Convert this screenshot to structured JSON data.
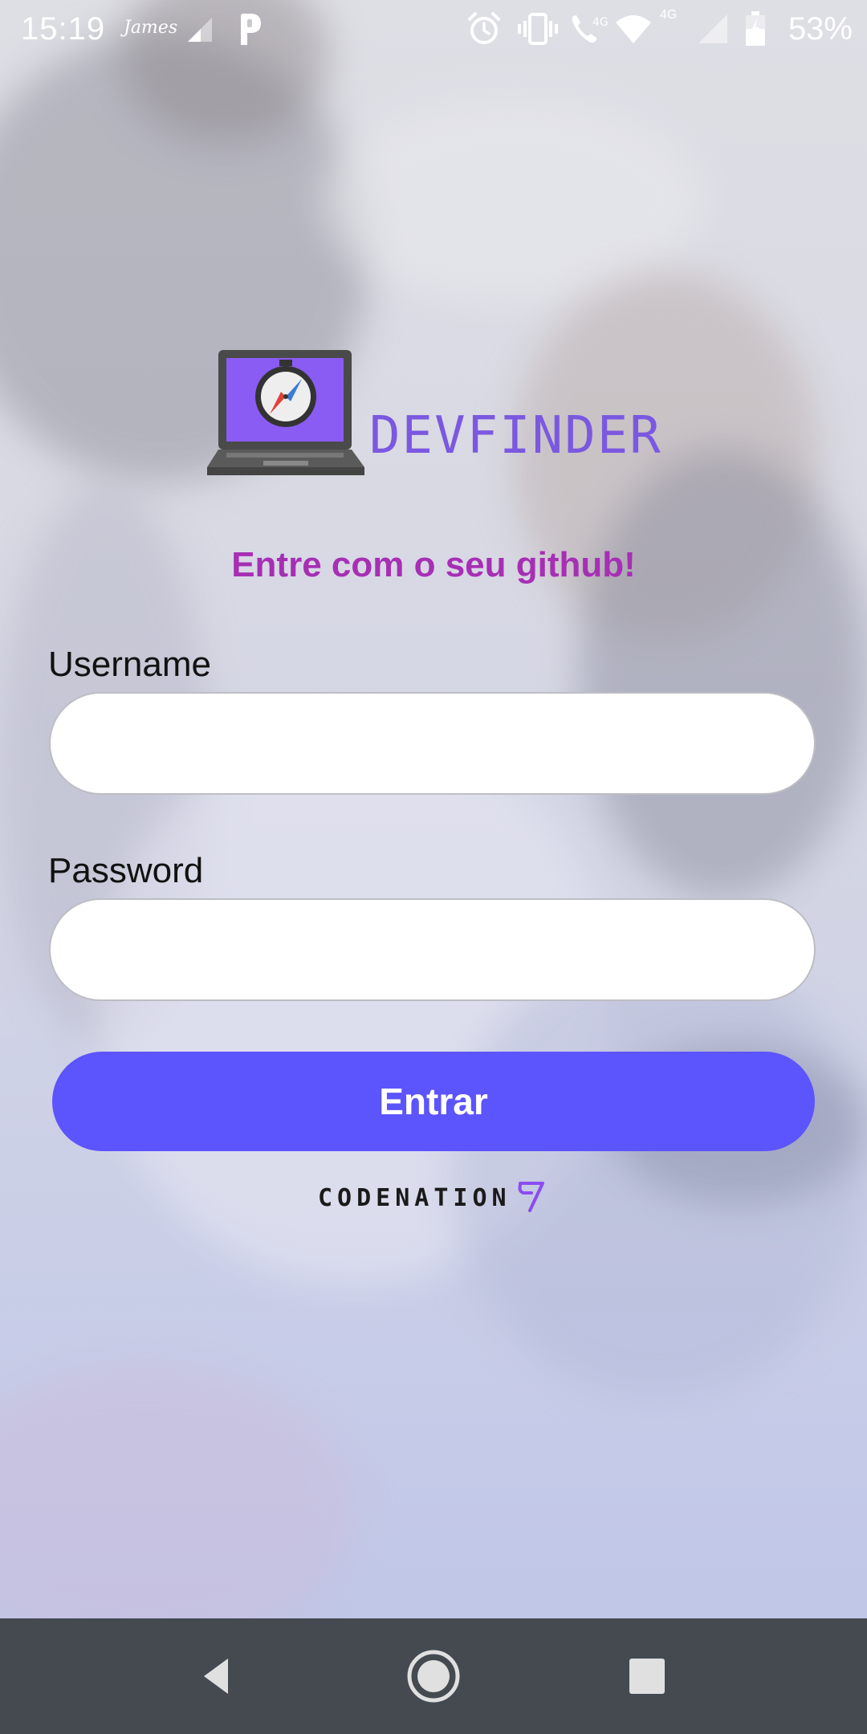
{
  "status_bar": {
    "time": "15:19",
    "carrier_brand": "James",
    "network_badge_1": "4G",
    "network_badge_2": "4G",
    "battery_percent": "53%",
    "icons": [
      "signal-weak-icon",
      "parking-app-icon",
      "alarm-icon",
      "vibrate-icon",
      "wifi-call-icon",
      "wifi-icon",
      "cell-signal-icon",
      "battery-icon"
    ]
  },
  "app": {
    "logo_text": "DEVFINDER",
    "tagline": "Entre com o seu github!",
    "colors": {
      "brand_purple": "#7b58e0",
      "tagline_magenta": "#a62fb4",
      "button_blue": "#5c54fc",
      "navbar_gray": "#444a50"
    }
  },
  "form": {
    "username_label": "Username",
    "username_value": "",
    "password_label": "Password",
    "password_value": "",
    "submit_label": "Entrar"
  },
  "footer": {
    "brand_text": "CODENATION"
  },
  "nav_bar": {
    "buttons": [
      "back-icon",
      "home-icon",
      "recents-icon"
    ]
  }
}
